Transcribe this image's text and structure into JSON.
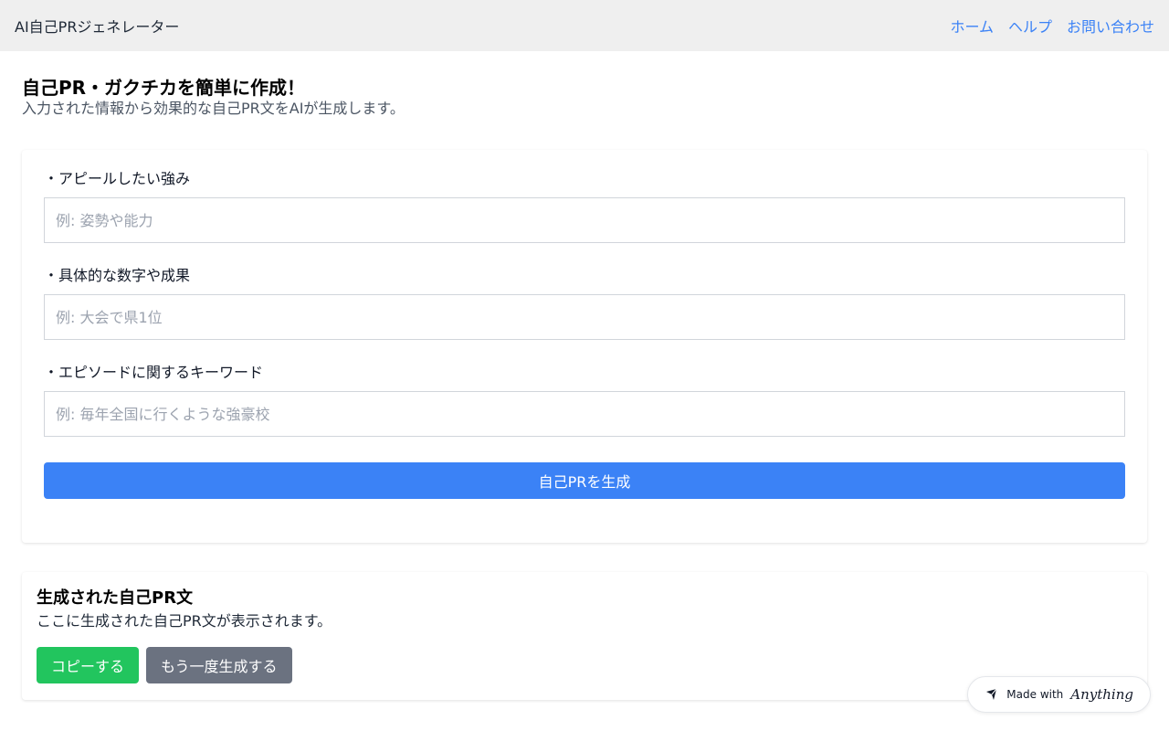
{
  "header": {
    "brand": "AI自己PRジェネレーター",
    "nav": [
      {
        "label": "ホーム"
      },
      {
        "label": "ヘルプ"
      },
      {
        "label": "お問い合わせ"
      }
    ]
  },
  "main": {
    "title": "自己PR・ガクチカを簡単に作成！",
    "subtitle": "入力された情報から効果的な自己PR文をAIが生成します。"
  },
  "form": {
    "fields": [
      {
        "label": "・アピールしたい強み",
        "placeholder": "例: 姿勢や能力",
        "value": ""
      },
      {
        "label": "・具体的な数字や成果",
        "placeholder": "例: 大会で県1位",
        "value": ""
      },
      {
        "label": "・エピソードに関するキーワード",
        "placeholder": "例: 毎年全国に行くような強豪校",
        "value": ""
      }
    ],
    "submit_label": "自己PRを生成"
  },
  "result": {
    "title": "生成された自己PR文",
    "text": "ここに生成された自己PR文が表示されます。",
    "copy_label": "コピーする",
    "regenerate_label": "もう一度生成する"
  },
  "badge": {
    "prefix": "Made with",
    "brand": "Anything",
    "icon": "anything-logo-icon"
  },
  "colors": {
    "primary": "#3b82f6",
    "copy": "#22c55e",
    "regenerate": "#6b7280",
    "header_bg": "#efefef"
  }
}
